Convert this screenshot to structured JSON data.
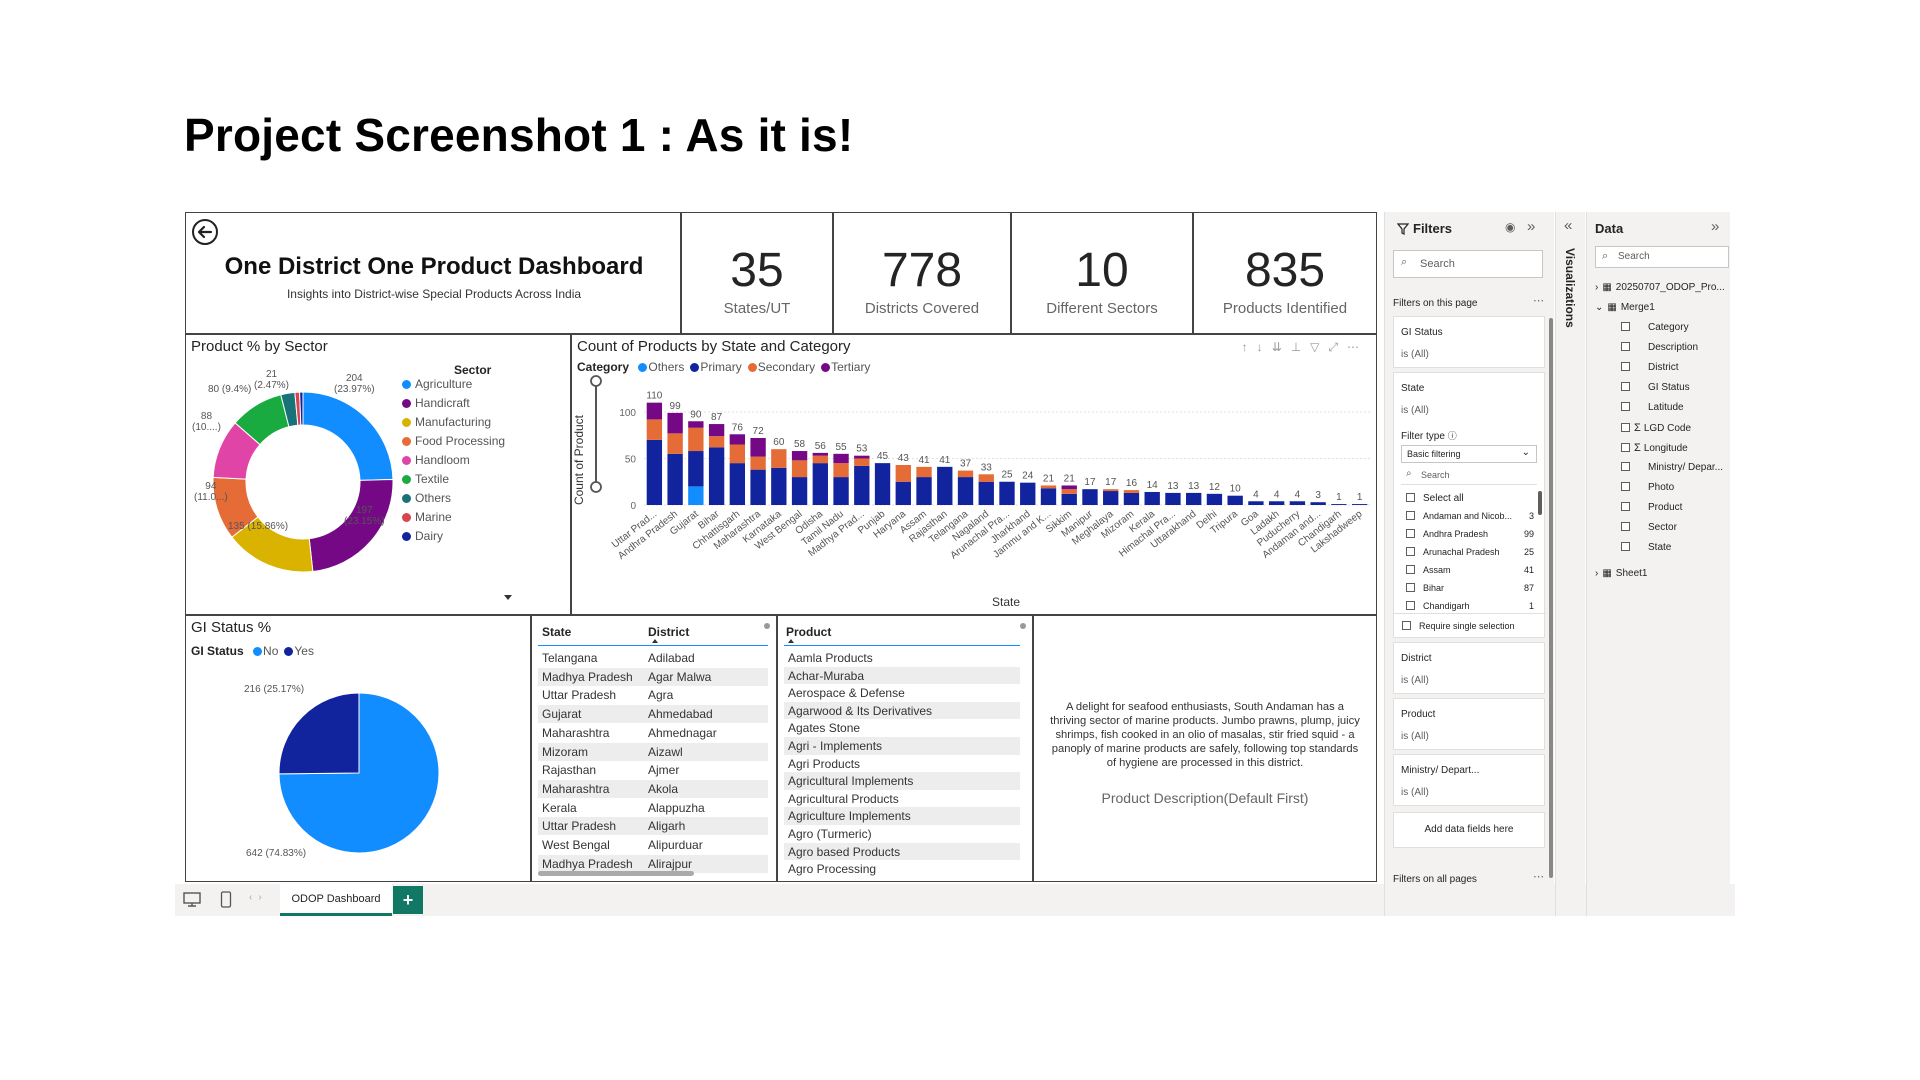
{
  "heading": "Project Screenshot 1 : As it is!",
  "title_panel": {
    "title": "One District One Product Dashboard",
    "subtitle": "Insights into District-wise Special Products Across India"
  },
  "kpis": [
    {
      "value": "35",
      "label": "States/UT"
    },
    {
      "value": "778",
      "label": "Districts Covered"
    },
    {
      "value": "10",
      "label": "Different Sectors"
    },
    {
      "value": "835",
      "label": "Products Identified"
    }
  ],
  "colors": {
    "agriculture": "#118DFF",
    "handicraft": "#750985",
    "manufacturing": "#D9B300",
    "food_processing": "#E66C37",
    "handloom": "#E044A7",
    "textile": "#1AAB40",
    "others": "#197278",
    "marine": "#D64550",
    "dairy": "#12239E",
    "accent": "#117865"
  },
  "sector_chart": {
    "title": "Product % by Sector",
    "legend_title": "Sector",
    "labels": [
      {
        "text": "204",
        "text2": "(23.97%)"
      },
      {
        "text": "197",
        "text2": "(23.15%)"
      },
      {
        "text": "135 (15.86%)",
        "text2": ""
      },
      {
        "text": "94",
        "text2": "(11.0...)"
      },
      {
        "text": "88",
        "text2": "(10....)"
      },
      {
        "text": "80 (9.4%)",
        "text2": ""
      },
      {
        "text": "21",
        "text2": "(2.47%)"
      }
    ]
  },
  "bar_chart": {
    "title": "Count of Products by State and Category",
    "legend_title": "Category",
    "ylabel": "Count of Product",
    "xlabel": "State"
  },
  "gi_chart": {
    "title": "GI Status %",
    "legend_title": "GI Status",
    "label_yes": "216 (25.17%)",
    "label_no": "642 (74.83%)"
  },
  "chart_data": [
    {
      "type": "pie",
      "title": "Product % by Sector",
      "legend": "Sector",
      "categories": [
        "Agriculture",
        "Handicraft",
        "Manufacturing",
        "Food Processing",
        "Handloom",
        "Textile",
        "Others",
        "Marine",
        "Dairy"
      ],
      "values": [
        204,
        197,
        135,
        94,
        88,
        80,
        21,
        7,
        5
      ],
      "percents": [
        "23.97%",
        "23.15%",
        "15.86%",
        "11.0...",
        "10....",
        "9.4%",
        "2.47%",
        "",
        ""
      ]
    },
    {
      "type": "bar",
      "stacked": true,
      "title": "Count of Products by State and Category",
      "xlabel": "State",
      "ylabel": "Count of Product",
      "ylim": [
        0,
        115
      ],
      "yticks": [
        0,
        50,
        100
      ],
      "grid": true,
      "legend": "top-left",
      "categories": [
        "Uttar Prad...",
        "Andhra Pradesh",
        "Gujarat",
        "Bihar",
        "Chhattisgarh",
        "Maharashtra",
        "Karnataka",
        "West Bengal",
        "Odisha",
        "Tamil Nadu",
        "Madhya Prad...",
        "Punjab",
        "Haryana",
        "Assam",
        "Rajasthan",
        "Telangana",
        "Nagaland",
        "Arunachal Pra...",
        "Jharkhand",
        "Jammu and K...",
        "Sikkim",
        "Manipur",
        "Meghalaya",
        "Mizoram",
        "Kerala",
        "Himachal Pra...",
        "Uttarakhand",
        "Delhi",
        "Tripura",
        "Goa",
        "Ladakh",
        "Puducherry",
        "Andaman and...",
        "Chandigarh",
        "Lakshadweep"
      ],
      "totals": [
        110,
        99,
        90,
        87,
        76,
        72,
        60,
        58,
        56,
        55,
        53,
        45,
        43,
        41,
        41,
        37,
        33,
        25,
        24,
        21,
        21,
        17,
        17,
        16,
        14,
        13,
        13,
        12,
        10,
        4,
        4,
        4,
        3,
        1,
        1
      ],
      "series": [
        {
          "name": "Others",
          "values": [
            0,
            0,
            20,
            0,
            0,
            0,
            0,
            0,
            0,
            0,
            0,
            0,
            0,
            0,
            0,
            0,
            0,
            0,
            0,
            0,
            0,
            0,
            0,
            0,
            0,
            0,
            0,
            0,
            0,
            0,
            0,
            0,
            0,
            0,
            0
          ]
        },
        {
          "name": "Primary",
          "values": [
            70,
            55,
            38,
            62,
            45,
            38,
            40,
            30,
            45,
            30,
            42,
            45,
            25,
            30,
            41,
            30,
            25,
            25,
            24,
            18,
            12,
            17,
            15,
            13,
            14,
            13,
            13,
            12,
            10,
            4,
            4,
            4,
            3,
            1,
            1
          ]
        },
        {
          "name": "Secondary",
          "values": [
            22,
            22,
            25,
            12,
            20,
            14,
            20,
            18,
            8,
            15,
            8,
            0,
            18,
            11,
            0,
            7,
            8,
            0,
            0,
            3,
            5,
            0,
            2,
            3,
            0,
            0,
            0,
            0,
            0,
            0,
            0,
            0,
            0,
            0,
            0
          ]
        },
        {
          "name": "Tertiary",
          "values": [
            18,
            22,
            7,
            13,
            11,
            20,
            0,
            10,
            3,
            10,
            3,
            0,
            0,
            0,
            0,
            0,
            0,
            0,
            0,
            0,
            4,
            0,
            0,
            0,
            0,
            0,
            0,
            0,
            0,
            0,
            0,
            0,
            0,
            0,
            0
          ]
        }
      ]
    },
    {
      "type": "pie",
      "title": "GI Status %",
      "legend": "GI Status",
      "categories": [
        "No",
        "Yes"
      ],
      "values": [
        642,
        216
      ],
      "percents": [
        "74.83%",
        "25.17%"
      ]
    }
  ],
  "state_district_table": {
    "headers": [
      "State",
      "District"
    ],
    "rows": [
      [
        "Telangana",
        "Adilabad"
      ],
      [
        "Madhya Pradesh",
        "Agar Malwa"
      ],
      [
        "Uttar Pradesh",
        "Agra"
      ],
      [
        "Gujarat",
        "Ahmedabad"
      ],
      [
        "Maharashtra",
        "Ahmednagar"
      ],
      [
        "Mizoram",
        "Aizawl"
      ],
      [
        "Rajasthan",
        "Ajmer"
      ],
      [
        "Maharashtra",
        "Akola"
      ],
      [
        "Kerala",
        "Alappuzha"
      ],
      [
        "Uttar Pradesh",
        "Aligarh"
      ],
      [
        "West Bengal",
        "Alipurduar"
      ],
      [
        "Madhya Pradesh",
        "Alirajpur"
      ]
    ]
  },
  "product_table": {
    "header": "Product",
    "rows": [
      "Aamla Products",
      "Achar-Muraba",
      "Aerospace & Defense",
      "Agarwood & Its Derivatives",
      "Agates Stone",
      "Agri - Implements",
      "Agri Products",
      "Agricultural Implements",
      "Agricultural Products",
      "Agriculture Implements",
      "Agro (Turmeric)",
      "Agro based Products",
      "Agro Processing"
    ]
  },
  "description": {
    "text": "A delight for seafood enthusiasts, South Andaman has a thriving sector of marine products. Jumbo prawns, plump, juicy shrimps, fish cooked in an olio of masalas, stir fried squid - a panoply of marine products are safely, following top standards of hygiene are processed in this district.",
    "caption": "Product Description(Default First)"
  },
  "tabbar": {
    "active_tab": "ODOP Dashboard",
    "add": "+"
  },
  "filters": {
    "title": "Filters",
    "search": "Search",
    "on_page": "Filters on this page",
    "cards": [
      {
        "name": "GI Status",
        "value": "is (All)"
      },
      {
        "name": "State",
        "value": "is (All)"
      }
    ],
    "filter_type_label": "Filter type",
    "filter_type_value": "Basic filtering",
    "inner_search": "Search",
    "select_all": "Select all",
    "state_items": [
      {
        "name": "Andaman and Nicob...",
        "count": "3"
      },
      {
        "name": "Andhra Pradesh",
        "count": "99"
      },
      {
        "name": "Arunachal Pradesh",
        "count": "25"
      },
      {
        "name": "Assam",
        "count": "41"
      },
      {
        "name": "Bihar",
        "count": "87"
      },
      {
        "name": "Chandigarh",
        "count": "1"
      }
    ],
    "require_single": "Require single selection",
    "more_cards": [
      {
        "name": "District",
        "value": "is (All)"
      },
      {
        "name": "Product",
        "value": "is (All)"
      },
      {
        "name": "Ministry/ Depart...",
        "value": "is (All)"
      }
    ],
    "add_fields": "Add data fields here",
    "all_pages": "Filters on all pages"
  },
  "visualizations": {
    "label": "Visualizations"
  },
  "data_pane": {
    "title": "Data",
    "search": "Search",
    "table1": "20250707_ODOP_Pro...",
    "table2": "Merge1",
    "fields": [
      {
        "name": "Category",
        "sigma": false
      },
      {
        "name": "Description",
        "sigma": false
      },
      {
        "name": "District",
        "sigma": false
      },
      {
        "name": "GI Status",
        "sigma": false
      },
      {
        "name": "Latitude",
        "sigma": false
      },
      {
        "name": "LGD Code",
        "sigma": true
      },
      {
        "name": "Longitude",
        "sigma": true
      },
      {
        "name": "Ministry/ Depar...",
        "sigma": false
      },
      {
        "name": "Photo",
        "sigma": false
      },
      {
        "name": "Product",
        "sigma": false
      },
      {
        "name": "Sector",
        "sigma": false
      },
      {
        "name": "State",
        "sigma": false
      }
    ],
    "table3": "Sheet1"
  }
}
